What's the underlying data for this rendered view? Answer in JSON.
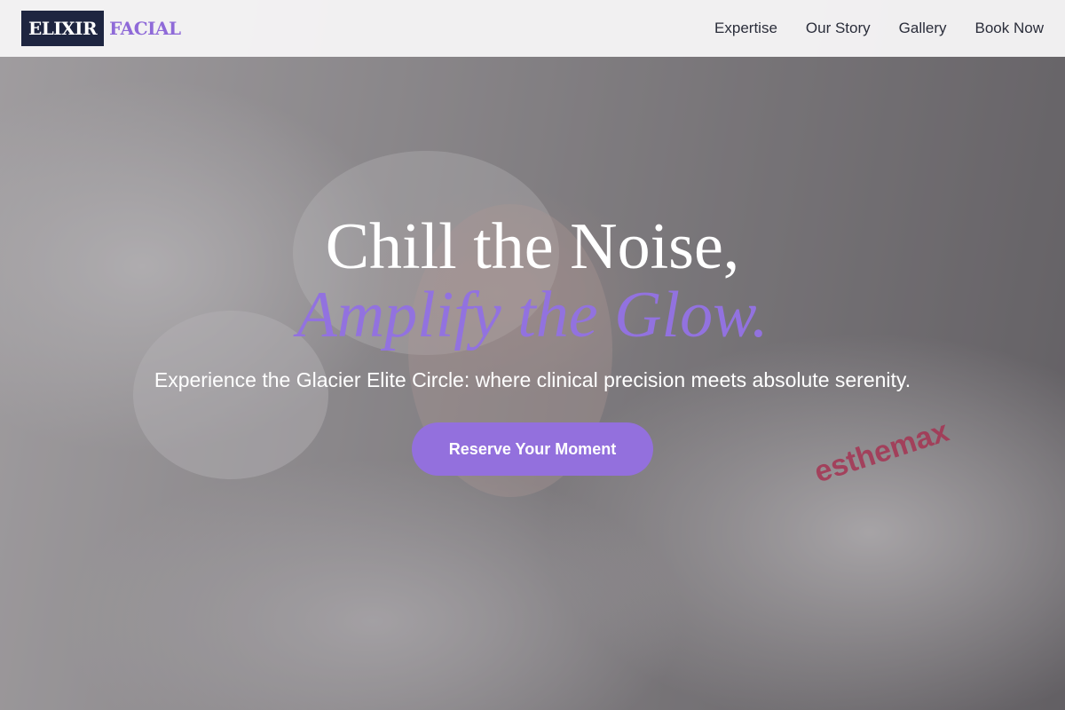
{
  "brand": {
    "logo_part1": "ELIXIR",
    "logo_part2": "FACIAL",
    "colors": {
      "navy": "#1e2540",
      "purple": "#9370dd"
    }
  },
  "nav": {
    "items": [
      {
        "label": "Expertise"
      },
      {
        "label": "Our Story"
      },
      {
        "label": "Gallery"
      },
      {
        "label": "Book Now"
      }
    ]
  },
  "hero": {
    "headline_line1": "Chill the Noise,",
    "headline_line2": "Amplify the Glow.",
    "subheadline": "Experience the Glacier Elite Circle: where clinical precision meets absolute serenity.",
    "cta_label": "Reserve Your Moment",
    "image_text": "esthemax"
  }
}
